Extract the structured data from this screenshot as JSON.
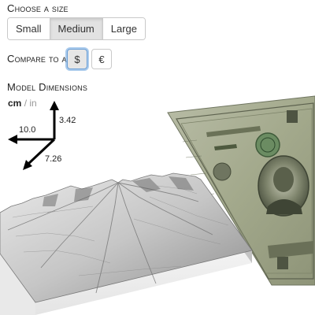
{
  "size": {
    "title": "Choose a size",
    "options": [
      "Small",
      "Medium",
      "Large"
    ],
    "selected": "Medium"
  },
  "compare": {
    "title": "Compare to a:",
    "options": [
      "$",
      "€"
    ],
    "selected": "$"
  },
  "dimensions": {
    "title": "Model Dimensions",
    "units": {
      "active": "cm",
      "separator": "/",
      "inactive": "in"
    },
    "width": "10.0",
    "height": "3.42",
    "depth": "7.26"
  },
  "colors": {
    "active_border": "#6a9ed6",
    "bill_green": "#8c9278",
    "terrain_gray": "#9a9a9a"
  },
  "icons": [
    "axis-arrows-icon",
    "terrain-model",
    "dollar-bill"
  ]
}
